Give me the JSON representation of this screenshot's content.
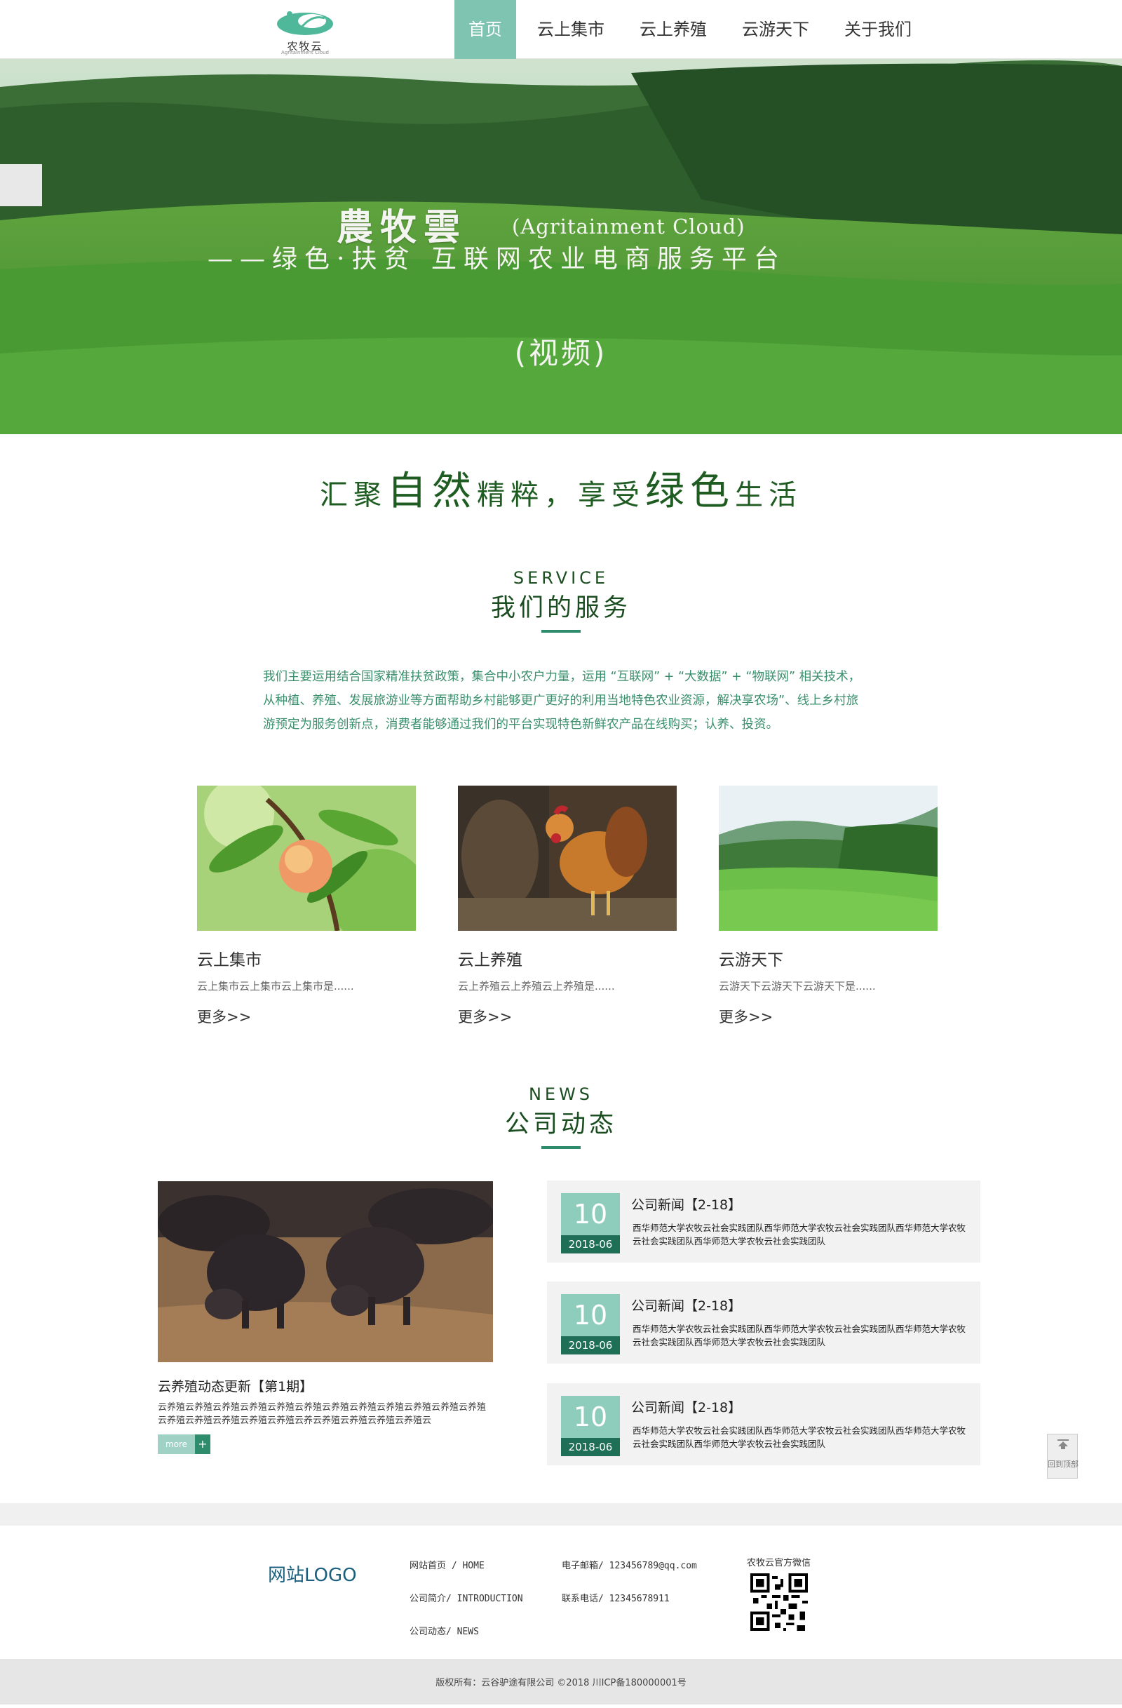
{
  "header": {
    "logo_text": "农牧云",
    "logo_sub": "Agritainment Cloud",
    "nav": [
      "首页",
      "云上集市",
      "云上养殖",
      "云游天下",
      "关于我们"
    ]
  },
  "banner": {
    "title": "農牧雲",
    "title_en": "(Agritainment Cloud)",
    "subtitle": "——绿色·扶贫 互联网农业电商服务平台",
    "video": "(视频)"
  },
  "slogan": {
    "p1": "汇聚",
    "b1": "自然",
    "p2": "精粹，享受",
    "b2": "绿色",
    "p3": "生活"
  },
  "service": {
    "en": "SERVICE",
    "cn": "我们的服务",
    "intro": "我们主要运用结合国家精准扶贫政策，集合中小农户力量，运用 “互联网” + “大数据” + “物联网” 相关技术，从种植、养殖、发展旅游业等方面帮助乡村能够更广更好的利用当地特色农业资源，解决享农场”、线上乡村旅游预定为服务创新点，消费者能够通过我们的平台实现特色新鲜农产品在线购买；认养、投资。",
    "cards": [
      {
        "title": "云上集市",
        "desc": "云上集市云上集市云上集市是......",
        "more": "更多>>"
      },
      {
        "title": "云上养殖",
        "desc": "云上养殖云上养殖云上养殖是......",
        "more": "更多>>"
      },
      {
        "title": "云游天下",
        "desc": "云游天下云游天下云游天下是......",
        "more": "更多>>"
      }
    ]
  },
  "news": {
    "en": "NEWS",
    "cn": "公司动态",
    "main": {
      "title": "云养殖动态更新【第1期】",
      "desc": "云养殖云养殖云养殖云养殖云养殖云养殖云养殖云养殖云养殖云养殖云养殖云养殖云养殖云养殖云养殖云养殖云养殖云养云养殖云养殖云养殖云养殖云",
      "more": "more",
      "plus": "+"
    },
    "items": [
      {
        "day": "10",
        "ym": "2018-06",
        "title": "公司新闻【2-18】",
        "desc": "西华师范大学农牧云社会实践团队西华师范大学农牧云社会实践团队西华师范大学农牧云社会实践团队西华师范大学农牧云社会实践团队"
      },
      {
        "day": "10",
        "ym": "2018-06",
        "title": "公司新闻【2-18】",
        "desc": "西华师范大学农牧云社会实践团队西华师范大学农牧云社会实践团队西华师范大学农牧云社会实践团队西华师范大学农牧云社会实践团队"
      },
      {
        "day": "10",
        "ym": "2018-06",
        "title": "公司新闻【2-18】",
        "desc": "西华师范大学农牧云社会实践团队西华师范大学农牧云社会实践团队西华师范大学农牧云社会实践团队西华师范大学农牧云社会实践团队"
      }
    ]
  },
  "totop": "回到顶部",
  "footer": {
    "logo": "网站LOGO",
    "links": [
      "网站首页 / HOME",
      "公司简介/ INTRODUCTION",
      "公司动态/ NEWS"
    ],
    "contact": [
      "电子邮箱/ 123456789@qq.com",
      "联系电话/ 12345678911"
    ],
    "qr_label": "农牧云官方微信",
    "copyright": "版权所有：云谷驴途有限公司     ©2018 川ICP备180000001号"
  },
  "colors": {
    "accent": "#7fc4b1",
    "dark_green": "#1f6f56",
    "title_green": "#1a4d1f"
  }
}
